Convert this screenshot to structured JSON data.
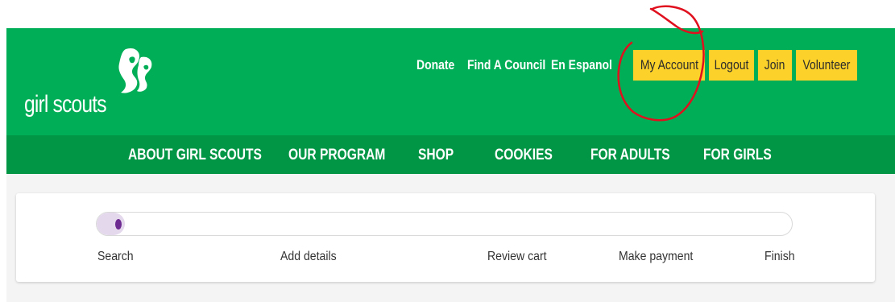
{
  "header": {
    "logo_text": "girl scouts",
    "utility_links": [
      "Donate",
      "Find A Council",
      "En Espanol"
    ],
    "account_buttons": [
      "My Account",
      "Logout",
      "Join",
      "Volunteer"
    ]
  },
  "nav": {
    "items": [
      "ABOUT GIRL SCOUTS",
      "OUR PROGRAM",
      "SHOP",
      "COOKIES",
      "FOR ADULTS",
      "FOR GIRLS"
    ]
  },
  "progress": {
    "current_step": 1,
    "total_steps": 5,
    "fill_fraction": 0.04,
    "steps": [
      "Search",
      "Add details",
      "Review cart",
      "Make payment",
      "Finish"
    ]
  },
  "colors": {
    "header_green": "#00ae58",
    "nav_green": "#009645",
    "button_yellow": "#fcd12a",
    "progress_purple": "#6d2b91",
    "progress_fill": "#e4d8ec",
    "annotation_red": "#e0101e"
  }
}
